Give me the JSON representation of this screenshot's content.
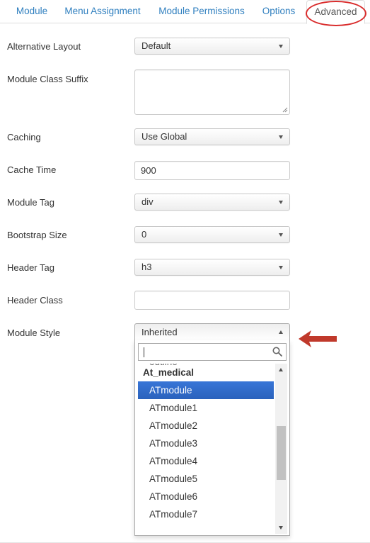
{
  "tabs": [
    {
      "label": "Module"
    },
    {
      "label": "Menu Assignment"
    },
    {
      "label": "Module Permissions"
    },
    {
      "label": "Options"
    },
    {
      "label": "Advanced"
    }
  ],
  "fields": {
    "alternative_layout": {
      "label": "Alternative Layout",
      "value": "Default"
    },
    "module_class_suffix": {
      "label": "Module Class Suffix",
      "value": ""
    },
    "caching": {
      "label": "Caching",
      "value": "Use Global"
    },
    "cache_time": {
      "label": "Cache Time",
      "value": "900"
    },
    "module_tag": {
      "label": "Module Tag",
      "value": "div"
    },
    "bootstrap_size": {
      "label": "Bootstrap Size",
      "value": "0"
    },
    "header_tag": {
      "label": "Header Tag",
      "value": "h3"
    },
    "header_class": {
      "label": "Header Class",
      "value": ""
    },
    "module_style": {
      "label": "Module Style",
      "value": "Inherited"
    }
  },
  "dropdown": {
    "search_value": "",
    "cut_option": "outline",
    "group_label": "At_medical",
    "options": [
      "ATmodule",
      "ATmodule1",
      "ATmodule2",
      "ATmodule3",
      "ATmodule4",
      "ATmodule5",
      "ATmodule6",
      "ATmodule7"
    ],
    "selected": "ATmodule",
    "scroll_position": 0.55
  },
  "colors": {
    "link": "#2f7fbf",
    "highlight": "#3875d7",
    "annotation": "#d92b2b",
    "arrow": "#c0392b"
  },
  "icons": [
    "search-icon",
    "caret-down-icon",
    "caret-up-icon",
    "resize-grip-icon",
    "arrow-left-annotation"
  ]
}
